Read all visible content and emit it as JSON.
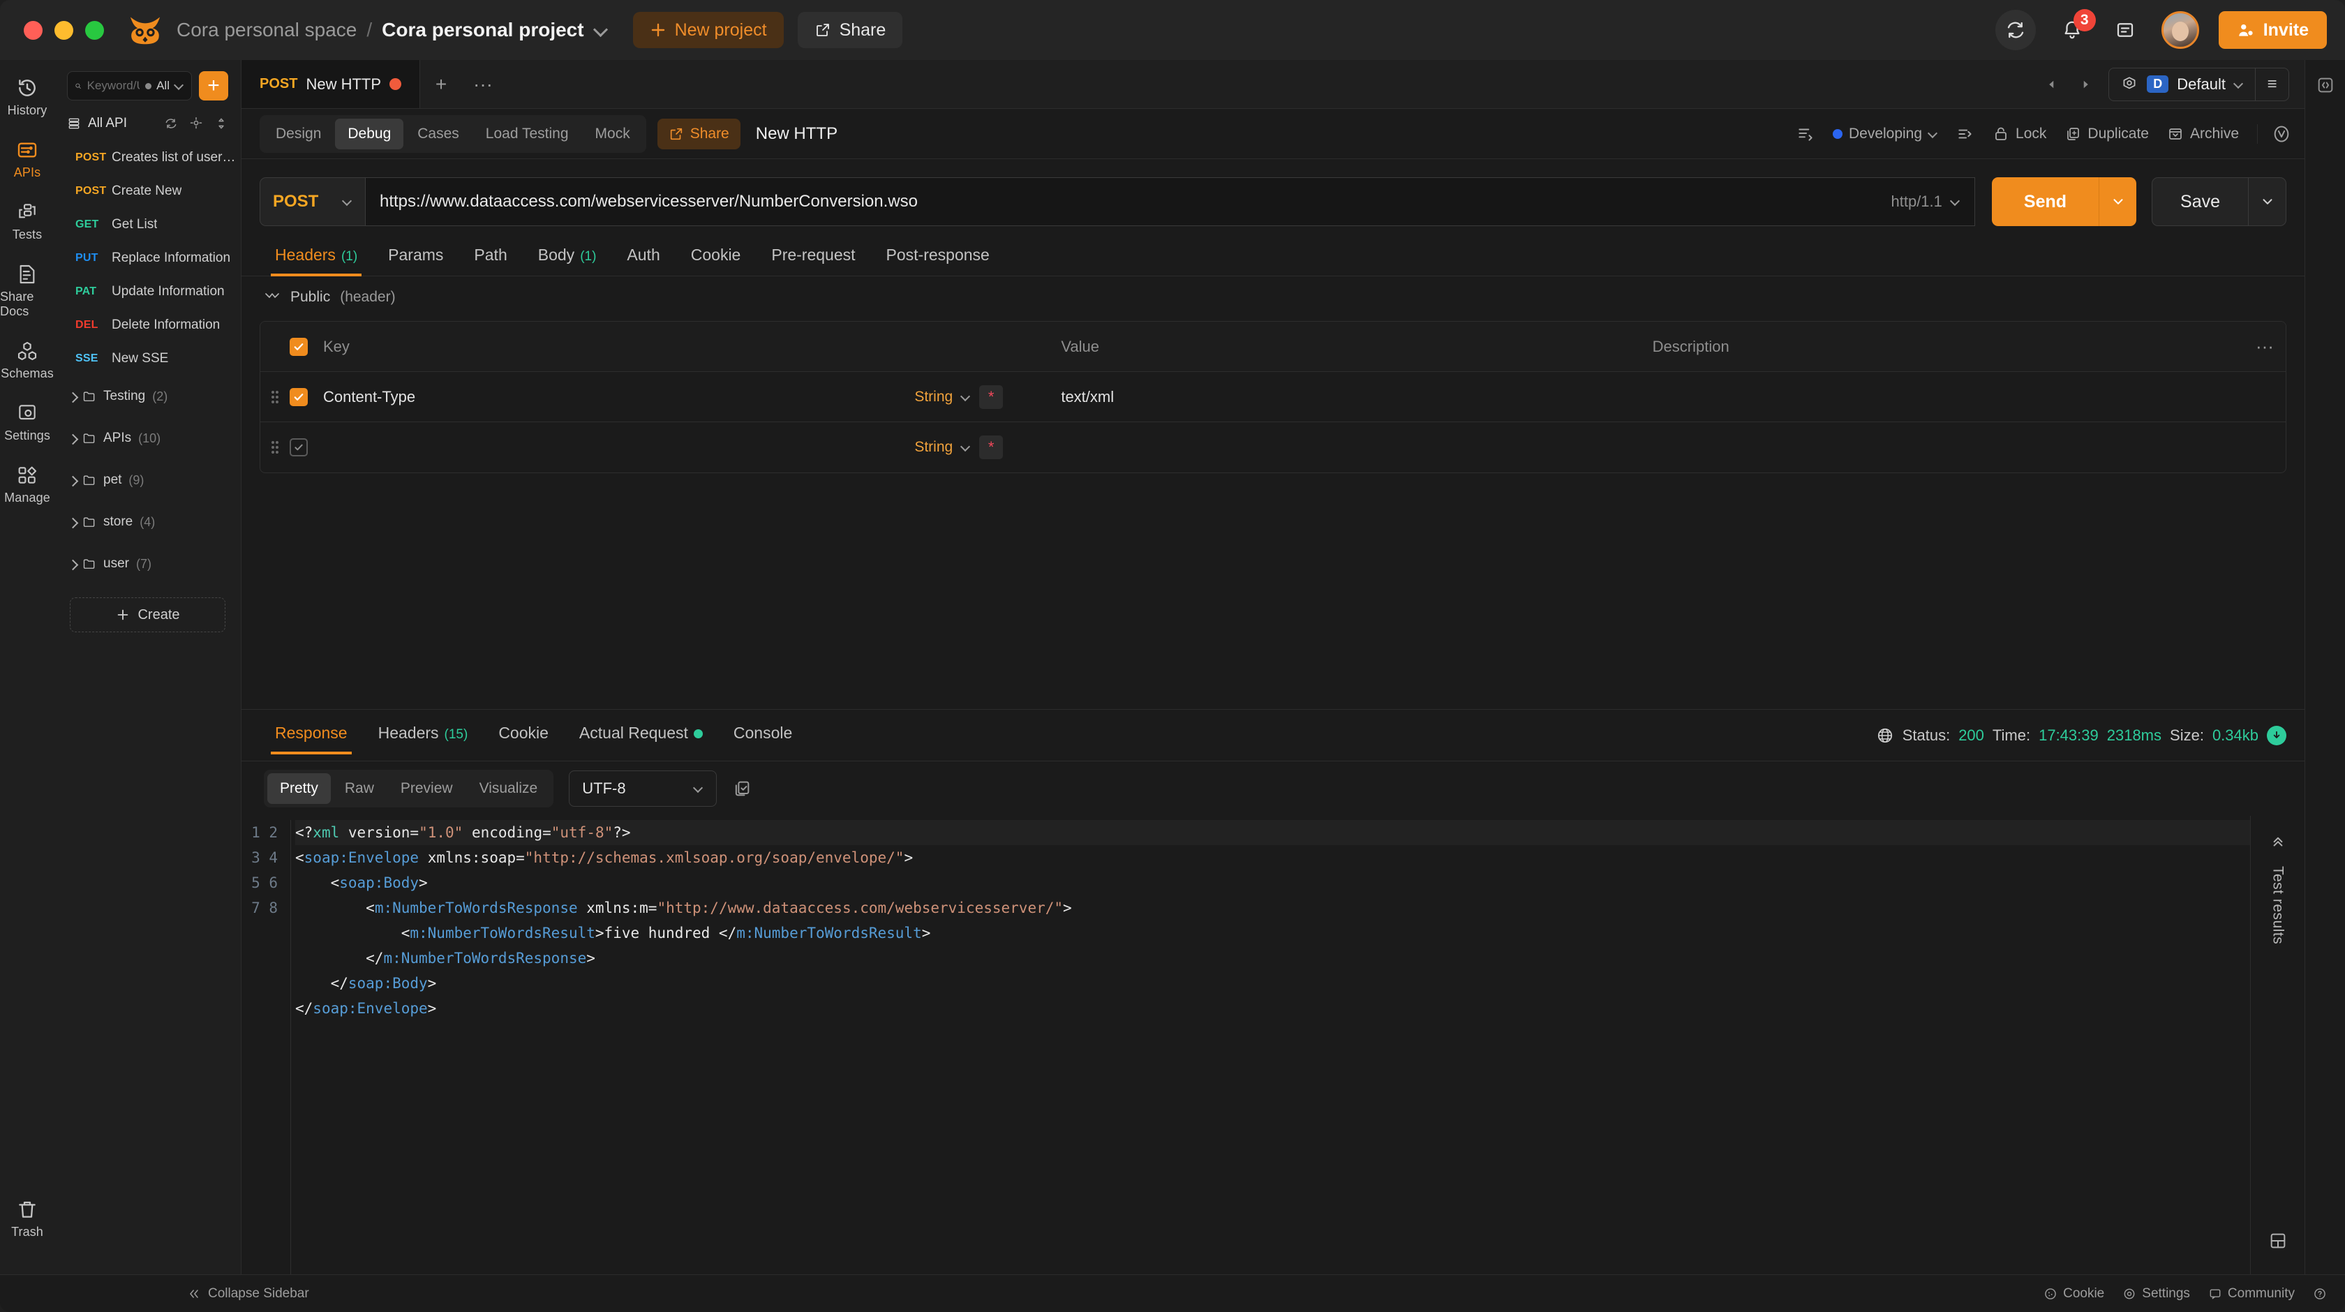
{
  "titlebar": {
    "space": "Cora personal space",
    "separator": "/",
    "project": "Cora personal project",
    "new_project": "New project",
    "share": "Share",
    "invite": "Invite",
    "notification_count": "3",
    "accent": "#f08c1e"
  },
  "rail": {
    "items": [
      {
        "label": "History",
        "icon": "history-icon",
        "active": false
      },
      {
        "label": "APIs",
        "icon": "apis-icon",
        "active": true
      },
      {
        "label": "Tests",
        "icon": "tests-icon",
        "active": false
      },
      {
        "label": "Share Docs",
        "icon": "share-docs-icon",
        "active": false
      },
      {
        "label": "Schemas",
        "icon": "schemas-icon",
        "active": false
      },
      {
        "label": "Settings",
        "icon": "settings-icon",
        "active": false
      },
      {
        "label": "Manage",
        "icon": "manage-icon",
        "active": false
      }
    ],
    "trash": "Trash"
  },
  "tree": {
    "search_placeholder": "Keyword/URL",
    "search_value": "",
    "filter": "All",
    "add_label": "+",
    "root": "All API",
    "nodes": [
      {
        "method": "POST",
        "name": "Creates list of users with ...",
        "cls": "m-post"
      },
      {
        "method": "POST",
        "name": "Create New",
        "cls": "m-post"
      },
      {
        "method": "GET",
        "name": "Get List",
        "cls": "m-get"
      },
      {
        "method": "PUT",
        "name": "Replace Information",
        "cls": "m-put"
      },
      {
        "method": "PAT",
        "name": "Update Information",
        "cls": "m-pat"
      },
      {
        "method": "DEL",
        "name": "Delete Information",
        "cls": "m-del"
      },
      {
        "method": "SSE",
        "name": "New SSE",
        "cls": "m-sse"
      }
    ],
    "folders": [
      {
        "name": "Testing",
        "count": "(2)"
      },
      {
        "name": "APIs",
        "count": "(10)"
      },
      {
        "name": "pet",
        "count": "(9)"
      },
      {
        "name": "store",
        "count": "(4)"
      },
      {
        "name": "user",
        "count": "(7)"
      }
    ],
    "create": "Create"
  },
  "tabstrip": {
    "tab_method": "POST",
    "tab_name": "New HTTP",
    "new_tab": "+",
    "more": "···",
    "env_badge": "D",
    "env_name": "Default"
  },
  "dochdr": {
    "segments": [
      "Design",
      "Debug",
      "Cases",
      "Load Testing",
      "Mock"
    ],
    "active_segment": "Debug",
    "share": "Share",
    "title": "New HTTP",
    "status": "Developing",
    "lock": "Lock",
    "duplicate": "Duplicate",
    "archive": "Archive"
  },
  "urlrow": {
    "method": "POST",
    "url": "https://www.dataaccess.com/webservicesserver/NumberConversion.wso",
    "protocol": "http/1.1",
    "send": "Send",
    "save": "Save"
  },
  "reqtabs": {
    "items": [
      {
        "label": "Headers",
        "count": "(1)",
        "active": true
      },
      {
        "label": "Params",
        "count": "",
        "active": false
      },
      {
        "label": "Path",
        "count": "",
        "active": false
      },
      {
        "label": "Body",
        "count": "(1)",
        "active": false
      },
      {
        "label": "Auth",
        "count": "",
        "active": false
      },
      {
        "label": "Cookie",
        "count": "",
        "active": false
      },
      {
        "label": "Pre-request",
        "count": "",
        "active": false
      },
      {
        "label": "Post-response",
        "count": "",
        "active": false
      }
    ]
  },
  "headers_table": {
    "group_label": "Public",
    "group_suffix": "(header)",
    "columns": {
      "key": "Key",
      "value": "Value",
      "description": "Description"
    },
    "rows": [
      {
        "checked": true,
        "key": "Content-Type",
        "type": "String",
        "required": "*",
        "value": "text/xml",
        "description": ""
      },
      {
        "checked": false,
        "key": "",
        "type": "String",
        "required": "*",
        "value": "",
        "description": ""
      }
    ]
  },
  "response": {
    "tabs": [
      {
        "label": "Response",
        "count": "",
        "dot": false,
        "active": true
      },
      {
        "label": "Headers",
        "count": "(15)",
        "dot": false,
        "active": false
      },
      {
        "label": "Cookie",
        "count": "",
        "dot": false,
        "active": false
      },
      {
        "label": "Actual Request",
        "count": "",
        "dot": true,
        "active": false
      },
      {
        "label": "Console",
        "count": "",
        "dot": false,
        "active": false
      }
    ],
    "status_label": "Status:",
    "status_value": "200",
    "time_label": "Time:",
    "time_value": "17:43:39",
    "duration_value": "2318ms",
    "size_label": "Size:",
    "size_value": "0.34kb",
    "view_modes": [
      "Pretty",
      "Raw",
      "Preview",
      "Visualize"
    ],
    "active_view": "Pretty",
    "encoding": "UTF-8",
    "test_results": "Test results",
    "code_lines": [
      "1",
      "2",
      "3",
      "4",
      "5",
      "6",
      "7",
      "8"
    ]
  },
  "code": {
    "lines": [
      "<?xml version=\"1.0\" encoding=\"utf-8\"?>",
      "<soap:Envelope xmlns:soap=\"http://schemas.xmlsoap.org/soap/envelope/\">",
      "    <soap:Body>",
      "        <m:NumberToWordsResponse xmlns:m=\"http://www.dataaccess.com/webservicesserver/\">",
      "            <m:NumberToWordsResult>five hundred </m:NumberToWordsResult>",
      "        </m:NumberToWordsResponse>",
      "    </soap:Body>",
      "</soap:Envelope>"
    ]
  },
  "bottombar": {
    "collapse": "Collapse Sidebar",
    "cookie": "Cookie",
    "settings": "Settings",
    "community": "Community"
  }
}
